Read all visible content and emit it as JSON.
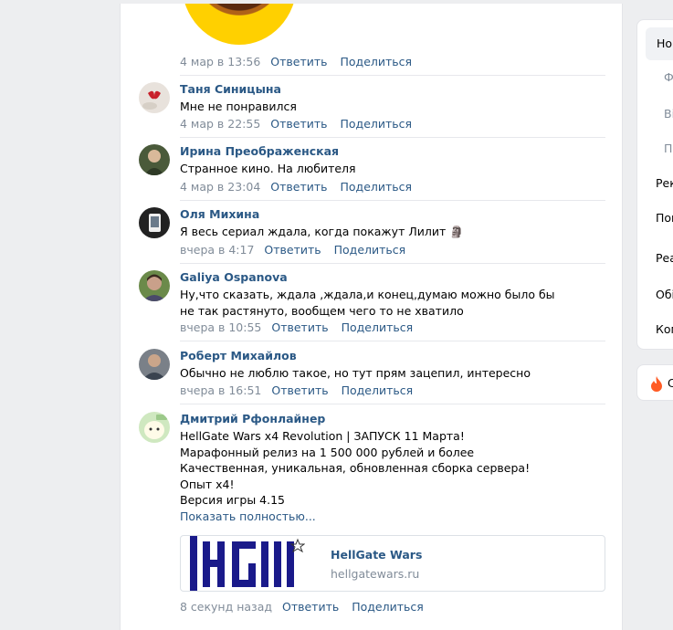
{
  "comments": [
    {
      "author": "",
      "text": "",
      "date": "4 мар в 13:56"
    },
    {
      "author": "Таня Синицына",
      "text": "Мне не понравился",
      "date": "4 мар в 22:55"
    },
    {
      "author": "Ирина Преображенская",
      "text": "Странное кино. На любителя",
      "date": "4 мар в 23:04"
    },
    {
      "author": "Оля Михина",
      "text": "Я весь сериал ждала, когда покажут Лилит 🗿",
      "date": "вчера в 4:17"
    },
    {
      "author": "Galiya Ospanova",
      "text": "Ну,что сказать, ждала ,ждала,и конец,думаю можно было бы не так растянуто, вообщем чего то не хватило",
      "date": "вчера в 10:55"
    },
    {
      "author": "Роберт Михайлов",
      "text": "Обычно не люблю такое, но тут прям зацепил, интересно",
      "date": "вчера в 16:51"
    },
    {
      "author": "Дмитрий Рфонлайнер",
      "lines": [
        "HellGate Wars x4 Revolution | ЗАПУСК 11 Марта!",
        "Марафонный релиз на 1 500 000 рублей и более",
        "Качественная, уникальная, обновленная сборка сервера!",
        "Опыт x4!",
        "Версия игры 4.15"
      ],
      "show_more": "Показать полностью...",
      "date": "8 секунд назад"
    }
  ],
  "actions": {
    "reply": "Ответить",
    "share": "Поделиться"
  },
  "link_card": {
    "title": "HellGate Wars",
    "domain": "hellgatewars.ru",
    "logo_text": "HG"
  },
  "right_menu": [
    "Ноі",
    "Ф",
    "Ві",
    "П",
    "Рек",
    "Пог",
    "Реа",
    "Обі",
    "Ком"
  ],
  "right_panel2_label": "С",
  "colors": {
    "link": "#2a5885",
    "meta": "#818c99",
    "divider": "#e7e8ec",
    "background": "#edeef0"
  }
}
